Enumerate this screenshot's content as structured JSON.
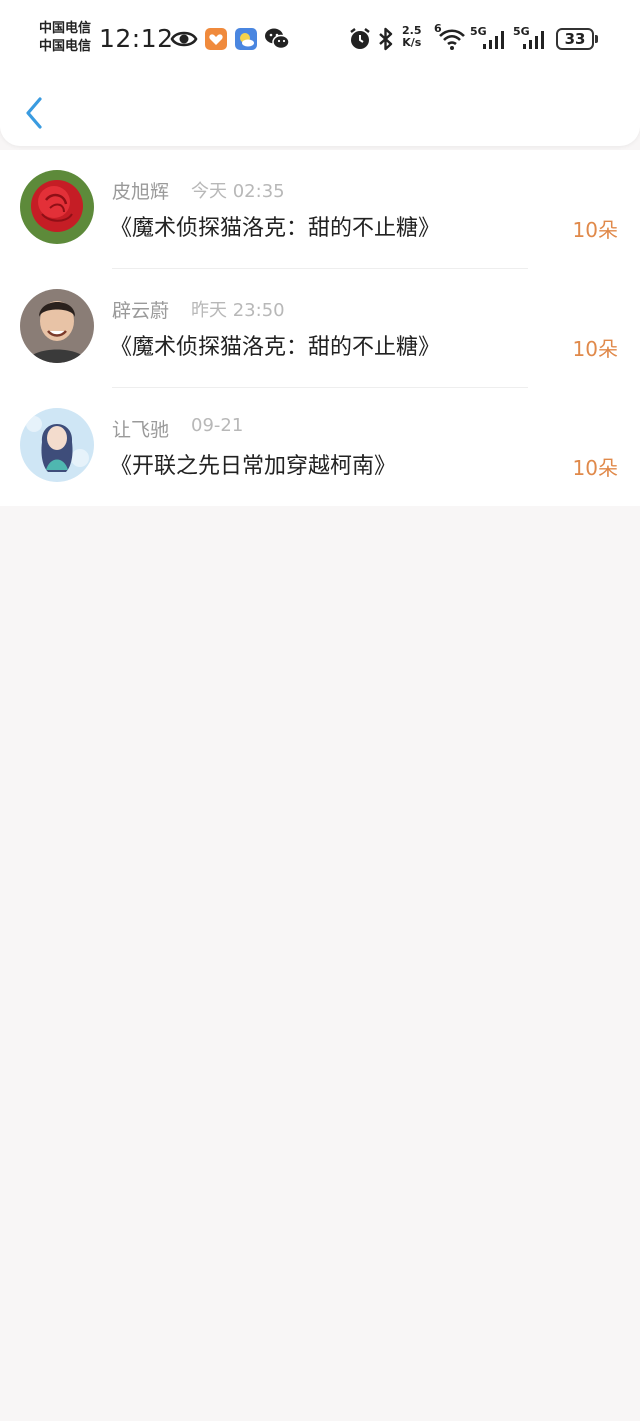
{
  "status_bar": {
    "carrier_1": "中国电信",
    "carrier_2": "中国电信",
    "time": "12:12",
    "net_speed_value": "2.5",
    "net_speed_unit": "K/s",
    "signal_1": "5G",
    "signal_2": "5G",
    "wifi_badge": "6",
    "battery": "33",
    "icons": [
      "eye-icon",
      "app-heart-icon",
      "weather-icon",
      "wechat-icon",
      "alarm-icon",
      "bluetooth-icon",
      "wifi-icon",
      "signal-icon",
      "battery-icon"
    ]
  },
  "header": {
    "back_icon": "chevron-left-icon",
    "accent_color": "#3a9be0"
  },
  "gifts": [
    {
      "name": "皮旭辉",
      "time": "今天 02:35",
      "title": "《魔术侦探猫洛克：甜的不止糖》",
      "amount": "10朵",
      "avatar": "rose-photo"
    },
    {
      "name": "辟云蔚",
      "time": "昨天 23:50",
      "title": "《魔术侦探猫洛克：甜的不止糖》",
      "amount": "10朵",
      "avatar": "person-photo"
    },
    {
      "name": "让飞驰",
      "time": "09-21",
      "title": "《开联之先日常加穿越柯南》",
      "amount": "10朵",
      "avatar": "anime-girl-illustration"
    }
  ],
  "colors": {
    "amount": "#e0894a",
    "page_background": "#f8f6f6"
  }
}
